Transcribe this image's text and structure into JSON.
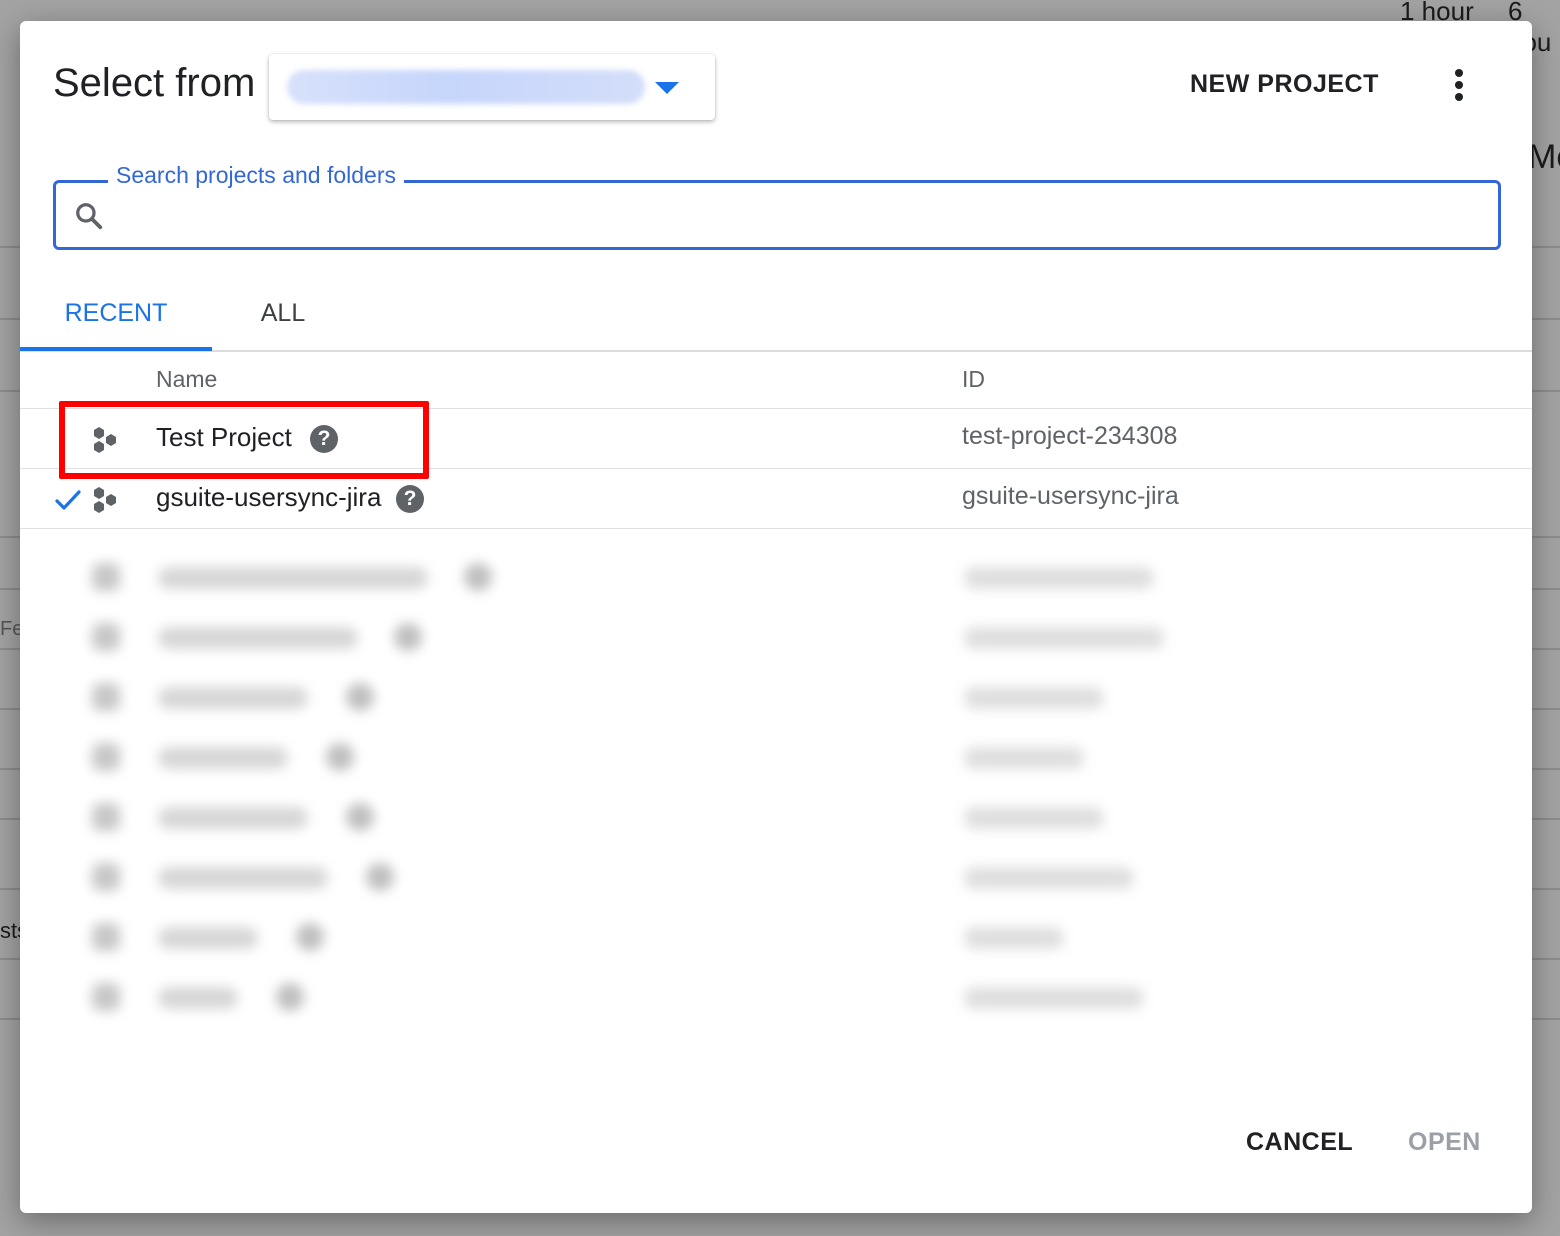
{
  "background": {
    "text_top_1": "1 hour",
    "text_top_2": "6 hou",
    "text_right": "Me",
    "text_left_1": "Fe",
    "text_left_2": "sts"
  },
  "dialog": {
    "title": "Select from",
    "org_selector": {
      "value": "",
      "icon": "chevron-down-icon"
    },
    "new_project_label": "NEW PROJECT",
    "more_icon": "more-vert-icon"
  },
  "search": {
    "label": "Search projects and folders",
    "value": "",
    "icon": "search-icon"
  },
  "tabs": [
    {
      "label": "RECENT",
      "active": true
    },
    {
      "label": "ALL",
      "active": false
    }
  ],
  "table": {
    "headers": {
      "name": "Name",
      "id": "ID"
    },
    "rows": [
      {
        "name": "Test Project",
        "id": "test-project-234308",
        "selected": false,
        "icon": "project-icon"
      },
      {
        "name": "gsuite-usersync-jira",
        "id": "gsuite-usersync-jira",
        "selected": true,
        "icon": "project-icon"
      }
    ]
  },
  "footer": {
    "cancel_label": "CANCEL",
    "open_label": "OPEN"
  },
  "colors": {
    "accent": "#1a73e8",
    "highlight": "#ff0000",
    "disabled": "#9aa0a6"
  }
}
